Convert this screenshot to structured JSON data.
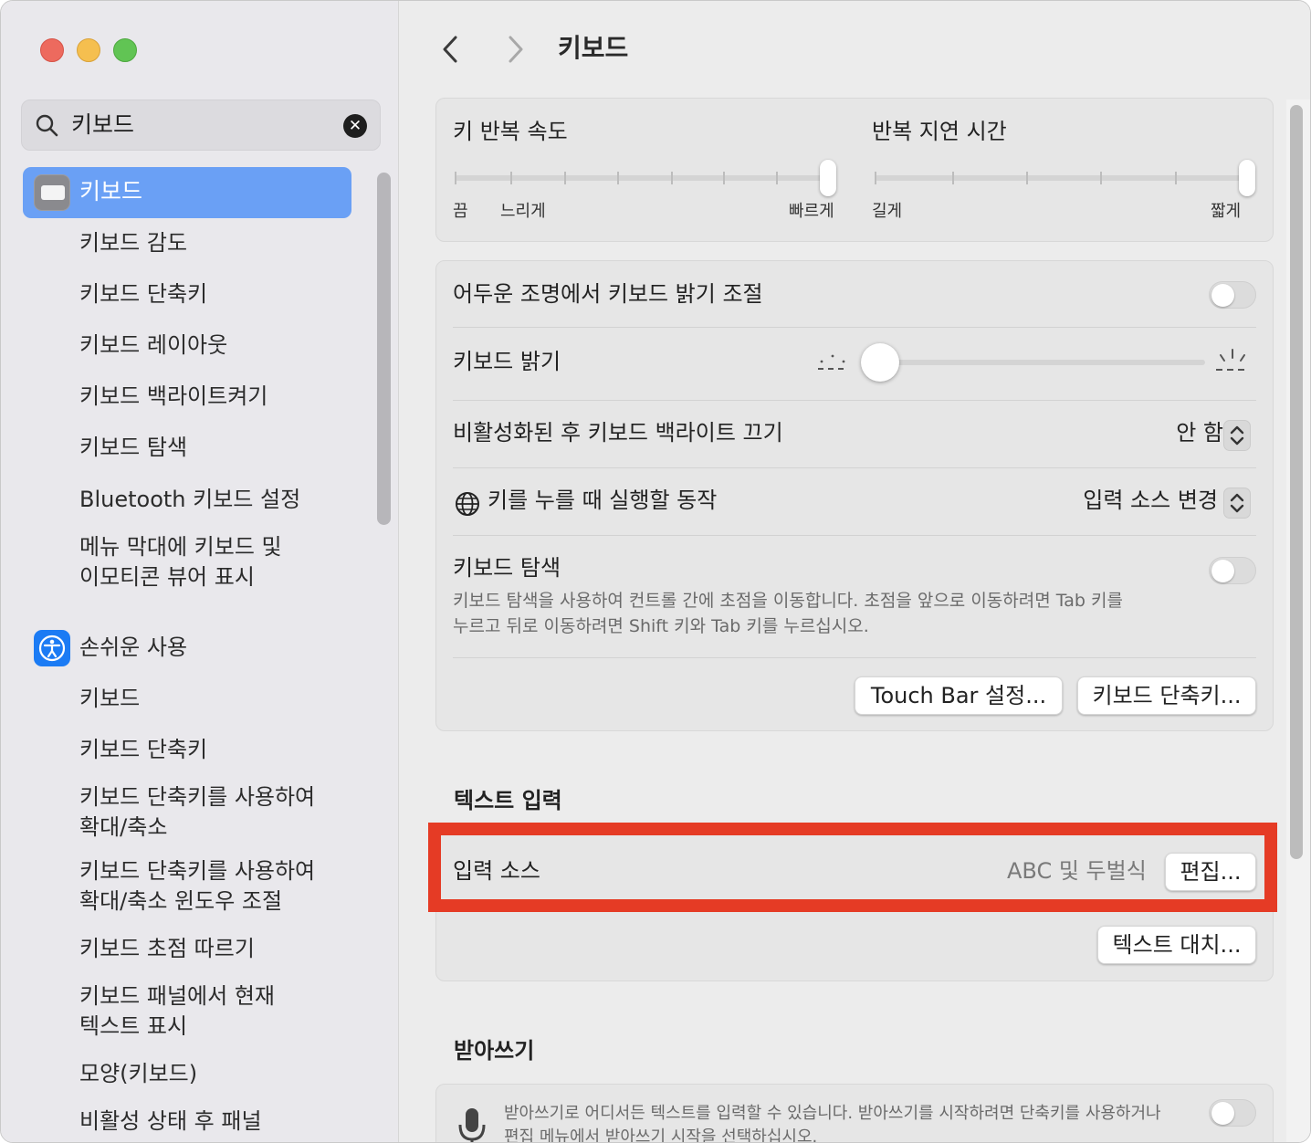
{
  "sidebar": {
    "search": {
      "value": "키보드"
    },
    "selected": {
      "label": "키보드"
    },
    "keyboard_items": [
      "키보드 감도",
      "키보드 단축키",
      "키보드 레이아웃",
      "키보드 백라이트켜기",
      "키보드 탐색",
      "Bluetooth 키보드 설정",
      "메뉴 막대에 키보드 및 이모티콘 뷰어 표시"
    ],
    "accessibility": {
      "label": "손쉬운 사용"
    },
    "accessibility_items": [
      "키보드",
      "키보드 단축키",
      "키보드 단축키를 사용하여 확대/축소",
      "키보드 단축키를 사용하여 확대/축소 윈도우 조절",
      "키보드 초점 따르기",
      "키보드 패널에서 현재 텍스트 표시",
      "모양(키보드)",
      "비활성 상태 후 패널"
    ]
  },
  "header": {
    "title": "키보드"
  },
  "repeat": {
    "key_repeat_label": "키 반복 속도",
    "key_repeat_min": "끔",
    "key_repeat_slow": "느리게",
    "key_repeat_max": "빠르게",
    "delay_label": "반복 지연 시간",
    "delay_min": "길게",
    "delay_max": "짧게"
  },
  "settings": {
    "dim_label": "어두운 조명에서 키보드 밝기 조절",
    "brightness_label": "키보드 밝기",
    "backlight_off_label": "비활성화된 후 키보드 백라이트 끄기",
    "backlight_off_value": "안 함",
    "globe_label": "키를 누를 때 실행할 동작",
    "globe_value": "입력 소스 변경",
    "nav_label": "키보드 탐색",
    "nav_desc_1": "키보드 탐색을 사용하여 컨트롤 간에 초점을 이동합니다. 초점을 앞으로 이동하려면 Tab 키를",
    "nav_desc_2": "누르고 뒤로 이동하려면 Shift 키와 Tab 키를 누르십시오.",
    "touchbar_button": "Touch Bar 설정...",
    "shortcuts_button": "키보드 단축키..."
  },
  "text_input": {
    "title": "텍스트 입력",
    "input_sources_label": "입력 소스",
    "input_sources_value": "ABC 및 두벌식",
    "edit_button": "편집...",
    "replacements_button": "텍스트 대치..."
  },
  "dictation": {
    "title": "받아쓰기",
    "desc_1": "받아쓰기로 어디서든 텍스트를 입력할 수 있습니다. 받아쓰기를 시작하려면 단축키를 사용하거나",
    "desc_2": "편집 메뉴에서 받아쓰기 시작을 선택하십시오."
  },
  "colors": {
    "selection": "#6aa0f5",
    "highlight_box": "#e53b25",
    "accessibility_icon": "#1b7bf4"
  }
}
